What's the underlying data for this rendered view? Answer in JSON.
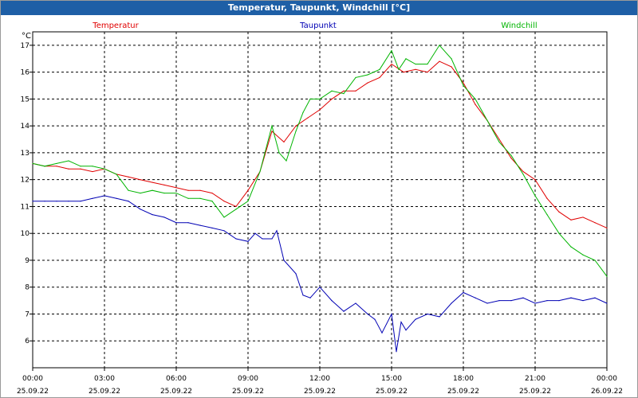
{
  "window": {
    "title": "Temperatur, Taupunkt, Windchill [°C]"
  },
  "chart_data": {
    "type": "line",
    "title": "Temperatur, Taupunkt, Windchill [°C]",
    "ylabel": "°C",
    "ylim": [
      5.0,
      17.5
    ],
    "yticks": [
      6.0,
      7.0,
      8.0,
      9.0,
      10.0,
      11.0,
      12.0,
      13.0,
      14.0,
      15.0,
      16.0,
      17.0
    ],
    "xlim": [
      0,
      24
    ],
    "xticks": [
      {
        "h": 0,
        "time": "00:00",
        "date": "25.09.22"
      },
      {
        "h": 3,
        "time": "03:00",
        "date": "25.09.22"
      },
      {
        "h": 6,
        "time": "06:00",
        "date": "25.09.22"
      },
      {
        "h": 9,
        "time": "09:00",
        "date": "25.09.22"
      },
      {
        "h": 12,
        "time": "12:00",
        "date": "25.09.22"
      },
      {
        "h": 15,
        "time": "15:00",
        "date": "25.09.22"
      },
      {
        "h": 18,
        "time": "18:00",
        "date": "25.09.22"
      },
      {
        "h": 21,
        "time": "21:00",
        "date": "25.09.22"
      },
      {
        "h": 24,
        "time": "00:00",
        "date": "26.09.22"
      }
    ],
    "grid": true,
    "legend": "top",
    "x_unit": "hours since 25.09.22 00:00",
    "series": [
      {
        "name": "Temperatur",
        "color": "#e00000",
        "x": [
          0,
          0.5,
          1,
          1.5,
          2,
          2.5,
          3,
          3.5,
          4,
          4.5,
          5,
          5.5,
          6,
          6.5,
          7,
          7.5,
          8,
          8.5,
          9,
          9.5,
          10,
          10.5,
          11,
          11.5,
          12,
          12.5,
          13,
          13.5,
          14,
          14.5,
          15,
          15.5,
          16,
          16.5,
          17,
          17.5,
          18,
          18.5,
          19,
          19.5,
          20,
          20.5,
          21,
          21.5,
          22,
          22.5,
          23,
          23.5,
          24
        ],
        "values": [
          12.6,
          12.5,
          12.5,
          12.4,
          12.4,
          12.3,
          12.4,
          12.2,
          12.1,
          12.0,
          11.9,
          11.8,
          11.7,
          11.6,
          11.6,
          11.5,
          11.2,
          11.0,
          11.6,
          12.3,
          13.8,
          13.4,
          14.0,
          14.3,
          14.6,
          15.0,
          15.3,
          15.3,
          15.6,
          15.8,
          16.3,
          16.0,
          16.1,
          16.0,
          16.4,
          16.2,
          15.6,
          14.8,
          14.2,
          13.5,
          12.8,
          12.3,
          12.0,
          11.3,
          10.8,
          10.5,
          10.6,
          10.4,
          10.2
        ]
      },
      {
        "name": "Taupunkt",
        "color": "#0000b4",
        "x": [
          0,
          0.5,
          1,
          1.5,
          2,
          2.5,
          3,
          3.5,
          4,
          4.5,
          5,
          5.5,
          6,
          6.5,
          7,
          7.5,
          8,
          8.5,
          9,
          9.3,
          9.6,
          10,
          10.2,
          10.5,
          11,
          11.3,
          11.6,
          12,
          12.5,
          13,
          13.5,
          14,
          14.3,
          14.6,
          15,
          15.2,
          15.4,
          15.6,
          16,
          16.5,
          17,
          17.5,
          18,
          18.5,
          19,
          19.5,
          20,
          20.5,
          21,
          21.5,
          22,
          22.5,
          23,
          23.5,
          24
        ],
        "values": [
          11.2,
          11.2,
          11.2,
          11.2,
          11.2,
          11.3,
          11.4,
          11.3,
          11.2,
          10.9,
          10.7,
          10.6,
          10.4,
          10.4,
          10.3,
          10.2,
          10.1,
          9.8,
          9.7,
          10.0,
          9.8,
          9.8,
          10.1,
          9.0,
          8.5,
          7.7,
          7.6,
          8.0,
          7.5,
          7.1,
          7.4,
          7.0,
          6.8,
          6.3,
          7.0,
          5.6,
          6.7,
          6.4,
          6.8,
          7.0,
          6.9,
          7.4,
          7.8,
          7.6,
          7.4,
          7.5,
          7.5,
          7.6,
          7.4,
          7.5,
          7.5,
          7.6,
          7.5,
          7.6,
          7.4
        ]
      },
      {
        "name": "Windchill",
        "color": "#00b400",
        "x": [
          0,
          0.5,
          1,
          1.5,
          2,
          2.5,
          3,
          3.5,
          4,
          4.5,
          5,
          5.5,
          6,
          6.5,
          7,
          7.5,
          8,
          8.5,
          9,
          9.5,
          10,
          10.3,
          10.6,
          11,
          11.3,
          11.6,
          12,
          12.5,
          13,
          13.5,
          14,
          14.5,
          15,
          15.3,
          15.6,
          16,
          16.5,
          17,
          17.5,
          18,
          18.5,
          19,
          19.5,
          20,
          20.5,
          21,
          21.5,
          22,
          22.5,
          23,
          23.5,
          24
        ],
        "values": [
          12.6,
          12.5,
          12.6,
          12.7,
          12.5,
          12.5,
          12.4,
          12.2,
          11.6,
          11.5,
          11.6,
          11.5,
          11.5,
          11.3,
          11.3,
          11.2,
          10.6,
          10.9,
          11.2,
          12.3,
          14.0,
          13.0,
          12.7,
          13.8,
          14.5,
          15.0,
          15.0,
          15.3,
          15.2,
          15.8,
          15.9,
          16.1,
          16.8,
          16.1,
          16.5,
          16.3,
          16.3,
          17.0,
          16.5,
          15.5,
          15.0,
          14.2,
          13.4,
          12.9,
          12.2,
          11.4,
          10.7,
          10.0,
          9.5,
          9.2,
          9.0,
          8.4
        ]
      }
    ]
  }
}
